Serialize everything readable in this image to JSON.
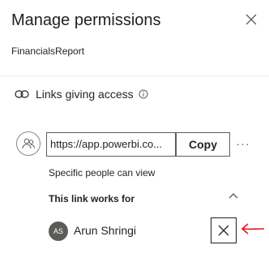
{
  "dialog": {
    "title": "Manage permissions",
    "report_name": "FinancialsReport",
    "close_icon": "close-icon"
  },
  "links_section": {
    "header": "Links giving access",
    "chain_icon": "link-chain-icon",
    "info_icon": "info-icon"
  },
  "link": {
    "url": "https://app.powerbi.co...",
    "copy_label": "Copy",
    "more_label": "···",
    "access_description": "Specific people can view",
    "works_for_label": "This link works for"
  },
  "people": [
    {
      "initials": "AS",
      "name": "Arun Shringi",
      "avatar_color": "#5c5b5a"
    }
  ],
  "annotation": {
    "arrow_color": "#e81123"
  }
}
